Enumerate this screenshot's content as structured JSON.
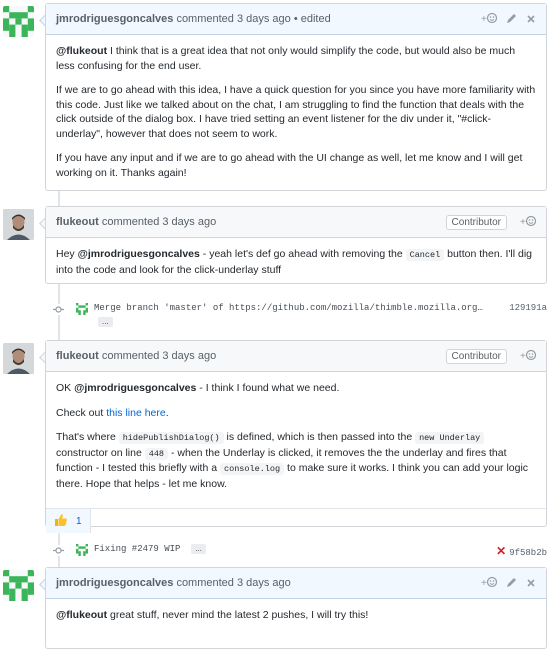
{
  "comments": [
    {
      "author": "jmrodriguesgoncalves",
      "meta": "commented 3 days ago • edited",
      "paragraphs": {
        "p1_mention": "@flukeout",
        "p1_rest": " I think that is a great idea that not only would simplify the code, but would also be much less confusing for the end user.",
        "p2": "If we are to go ahead with this idea, I have a quick question for you since you have more familiarity with this code. Just like we talked about on the chat, I am struggling to find the function that deals with the click outside of the dialog box. I have tried setting an event listener for the div under it, \"#click-underlay\", however that does not seem to work.",
        "p3": "If you have any input and if we are to go ahead with the UI change as well, let me know and I will get working on it. Thanks again!"
      }
    },
    {
      "author": "flukeout",
      "meta": "commented 3 days ago",
      "badge": "Contributor",
      "b_pre": "Hey ",
      "b_mention": "@jmrodriguesgoncalves",
      "b_mid": " - yeah let's def go ahead with removing the ",
      "b_code": "Cancel",
      "b_post": " button then. I'll dig into the code and look for the click-underlay stuff"
    },
    {
      "author": "flukeout",
      "meta": "commented 3 days ago",
      "badge": "Contributor",
      "p1_pre": "OK ",
      "p1_mention": "@jmrodriguesgoncalves",
      "p1_post": " - I think I found what we need.",
      "p2_pre": "Check out ",
      "p2_link": "this line here",
      "p2_post": ".",
      "p3_a": "That's where ",
      "p3_code1": "hidePublishDialog()",
      "p3_b": " is defined, which is then passed into the ",
      "p3_code2": "new Underlay",
      "p3_c": " constructor on line ",
      "p3_code3": "448",
      "p3_d": " - when the Underlay is clicked, it removes the the underlay and fires that function - I tested this briefly with a ",
      "p3_code4": "console.log",
      "p3_e": " to make sure it works. I think you can add your logic there. Hope that helps - let me know.",
      "reaction_count": "1"
    },
    {
      "author": "jmrodriguesgoncalves",
      "meta": "commented 3 days ago",
      "b_mention": "@flukeout",
      "b_rest": " great stuff, never mind the latest 2 pushes, I will try this!"
    }
  ],
  "commits": [
    {
      "message": "Merge branch 'master' of https://github.com/mozilla/thimble.mozilla.org…",
      "ellipsis": "...",
      "sha": "129191a"
    },
    {
      "message": "Fixing #2479 WIP",
      "ellipsis": "...",
      "sha": "9f58b2b"
    }
  ],
  "icons": {
    "emoji": "smiley-add-icon",
    "edit": "pencil-icon",
    "close": "x-icon",
    "thumbs": "thumbs-up-icon",
    "commit": "git-commit-icon",
    "status_fail": "x-mark-icon"
  },
  "colors": {
    "link": "#0366d6",
    "header_blue": "#f1f8ff",
    "fail": "#cb2431",
    "identicon": "#3cb55a"
  }
}
